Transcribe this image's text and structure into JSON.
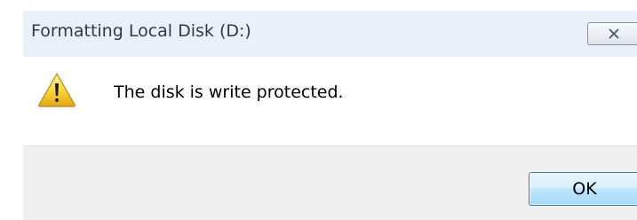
{
  "dialog": {
    "title": "Formatting Local Disk (D:)",
    "message": "The disk is write protected.",
    "ok_label": "OK",
    "icon": "warning-icon",
    "close_icon": "close-icon"
  }
}
